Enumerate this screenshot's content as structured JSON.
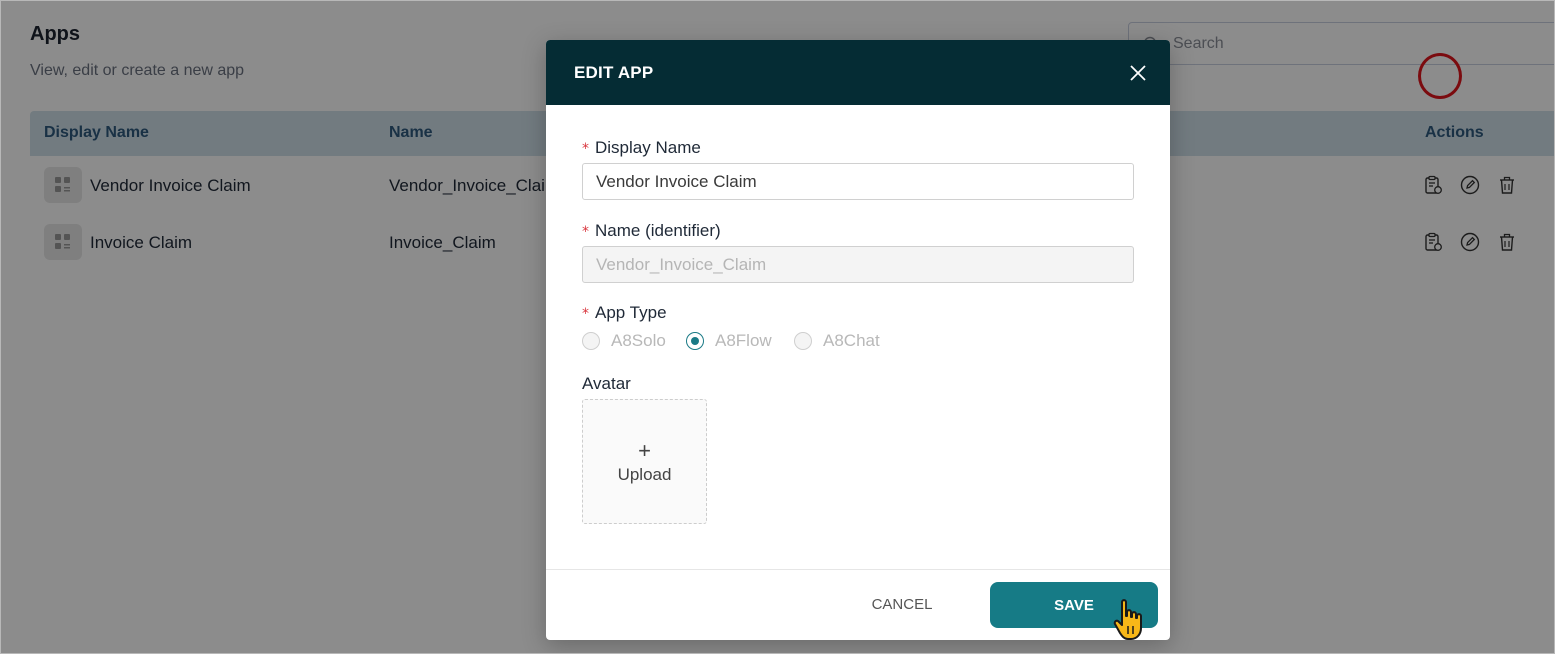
{
  "page": {
    "title": "Apps",
    "subtitle": "View, edit or create a new app",
    "search_placeholder": "Search"
  },
  "table": {
    "headers": {
      "display_name": "Display Name",
      "name": "Name",
      "actions": "Actions"
    },
    "rows": [
      {
        "display_name": "Vendor Invoice Claim",
        "name": "Vendor_Invoice_Claim"
      },
      {
        "display_name": "Invoice Claim",
        "name": "Invoice_Claim"
      }
    ]
  },
  "modal": {
    "title": "EDIT APP",
    "fields": {
      "display_name_label": "Display Name",
      "display_name_value": "Vendor Invoice Claim",
      "name_label": "Name (identifier)",
      "name_value": "Vendor_Invoice_Claim",
      "app_type_label": "App Type",
      "avatar_label": "Avatar"
    },
    "app_types": [
      {
        "label": "A8Solo",
        "checked": false
      },
      {
        "label": "A8Flow",
        "checked": true
      },
      {
        "label": "A8Chat",
        "checked": false
      }
    ],
    "upload_plus": "+",
    "upload_label": "Upload",
    "cancel_label": "CANCEL",
    "save_label": "SAVE"
  },
  "colors": {
    "modal_header": "#052c34",
    "save_button": "#167b86",
    "table_header": "#cfe0ea",
    "highlight_ring": "#e0141c",
    "required_star": "#d9363e"
  },
  "icons": {
    "search": "search-icon",
    "app_tile": "app-grid-icon",
    "view": "clipboard-icon",
    "edit": "edit-icon",
    "delete": "trash-icon",
    "close": "close-icon",
    "pointer": "hand-pointer-icon"
  }
}
